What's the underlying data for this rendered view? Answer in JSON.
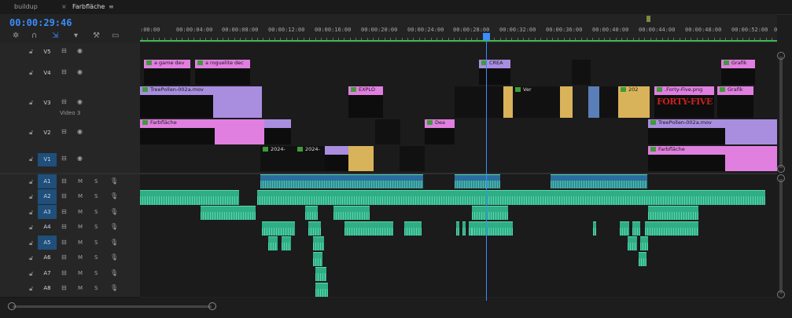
{
  "tabs": [
    {
      "label": "buildup"
    },
    {
      "label": "Farbfläche"
    }
  ],
  "timecode": "00:00:29:46",
  "tools": {
    "ripple": "snap-icon",
    "magnet": "magnet-icon",
    "linked": "linked-icon",
    "marker": "marker-icon",
    "wrench": "wrench-icon",
    "caption": "caption-icon"
  },
  "ruler": {
    "labels": [
      ":00:00",
      "00:00:04:00",
      "00:00:08:00",
      "00:00:12:00",
      "00:00:16:00",
      "00:00:20:00",
      "00:00:24:00",
      "00:00:28:00",
      "00:00:32:00",
      "00:00:36:00",
      "00:00:40:00",
      "00:00:44:00",
      "00:00:48:00",
      "00:00:52:00",
      "0"
    ]
  },
  "video_tracks": [
    {
      "id": "V5",
      "label": "V5",
      "name": ""
    },
    {
      "id": "V4",
      "label": "V4",
      "name": ""
    },
    {
      "id": "V3",
      "label": "V3",
      "name": "Video 3"
    },
    {
      "id": "V2",
      "label": "V2",
      "name": ""
    },
    {
      "id": "V1",
      "label": "V1",
      "name": ""
    }
  ],
  "audio_tracks": [
    {
      "id": "A1",
      "label": "A1"
    },
    {
      "id": "A2",
      "label": "A2"
    },
    {
      "id": "A3",
      "label": "A3"
    },
    {
      "id": "A4",
      "label": "A4"
    },
    {
      "id": "A5",
      "label": "A5"
    },
    {
      "id": "A6",
      "label": "A6"
    },
    {
      "id": "A7",
      "label": "A7"
    },
    {
      "id": "A8",
      "label": "A8"
    }
  ],
  "audio_buttons": {
    "mute": "M",
    "solo": "S"
  },
  "clips": {
    "v4_a": "a game dev",
    "v4_b": "a roguelite dec",
    "v4_c": "CREA",
    "v4_d": "Grafik",
    "v3_a": "TreePollen-002a.mov",
    "v3_b": "EXPLO",
    "v3_c": "Ver",
    "v3_d": "202",
    "v3_e": ".Forty-Five.png",
    "v3_f": "Grafik",
    "v3_g": "FORTY-FIVE",
    "v2_a": "Farbfläche",
    "v2_b": "Dea",
    "v2_c": "TreePollen-002a.mov",
    "v1_a": "2024-",
    "v1_b": "2024-",
    "v1_c": "Farbfläche"
  },
  "colors": {
    "accent": "#3b8cff",
    "video_clip_pink": "#e07fe0",
    "video_clip_lavender": "#a98ee0",
    "audio_clip": "#2fae86",
    "work_area": "#3fb94d"
  }
}
